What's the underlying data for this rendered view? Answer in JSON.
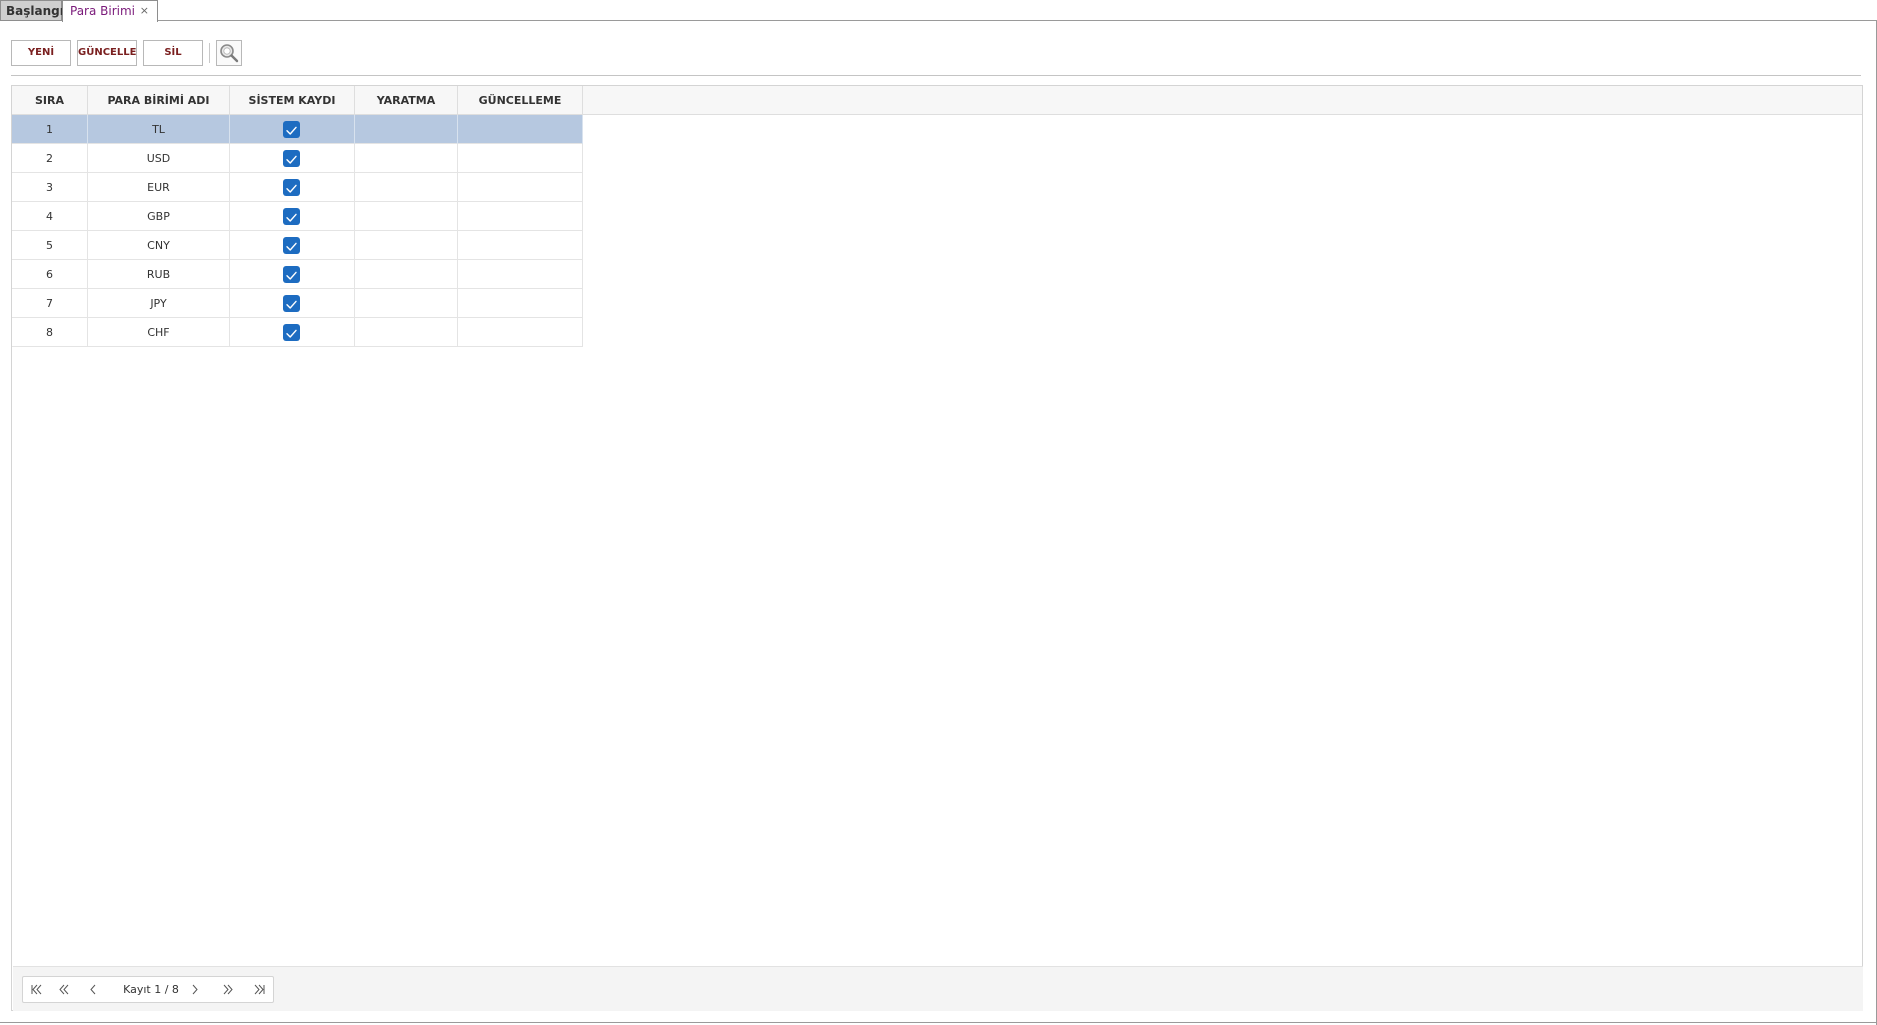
{
  "tabs": {
    "home_label": "Başlangıç",
    "active_label": "Para Birimi",
    "close_glyph": "×"
  },
  "toolbar": {
    "new_label": "YENİ",
    "update_label": "GÜNCELLE",
    "delete_label": "SİL",
    "search_icon": "magnifier-icon"
  },
  "grid": {
    "columns": [
      "SIRA",
      "PARA BİRİMİ ADI",
      "SİSTEM KAYDI",
      "YARATMA",
      "GÜNCELLEME"
    ],
    "selected_row": 1,
    "rows": [
      {
        "order": "1",
        "name": "TL",
        "system": true,
        "created": "",
        "updated": ""
      },
      {
        "order": "2",
        "name": "USD",
        "system": true,
        "created": "",
        "updated": ""
      },
      {
        "order": "3",
        "name": "EUR",
        "system": true,
        "created": "",
        "updated": ""
      },
      {
        "order": "4",
        "name": "GBP",
        "system": true,
        "created": "",
        "updated": ""
      },
      {
        "order": "5",
        "name": "CNY",
        "system": true,
        "created": "",
        "updated": ""
      },
      {
        "order": "6",
        "name": "RUB",
        "system": true,
        "created": "",
        "updated": ""
      },
      {
        "order": "7",
        "name": "JPY",
        "system": true,
        "created": "",
        "updated": ""
      },
      {
        "order": "8",
        "name": "CHF",
        "system": true,
        "created": "",
        "updated": ""
      }
    ]
  },
  "pager": {
    "record_text": "Kayıt 1 / 8"
  },
  "colors": {
    "selected_row": "#b6c8e0",
    "checkbox": "#1d6cc1",
    "button_text": "#7a1f1f",
    "active_tab_text": "#7a1a7a"
  }
}
